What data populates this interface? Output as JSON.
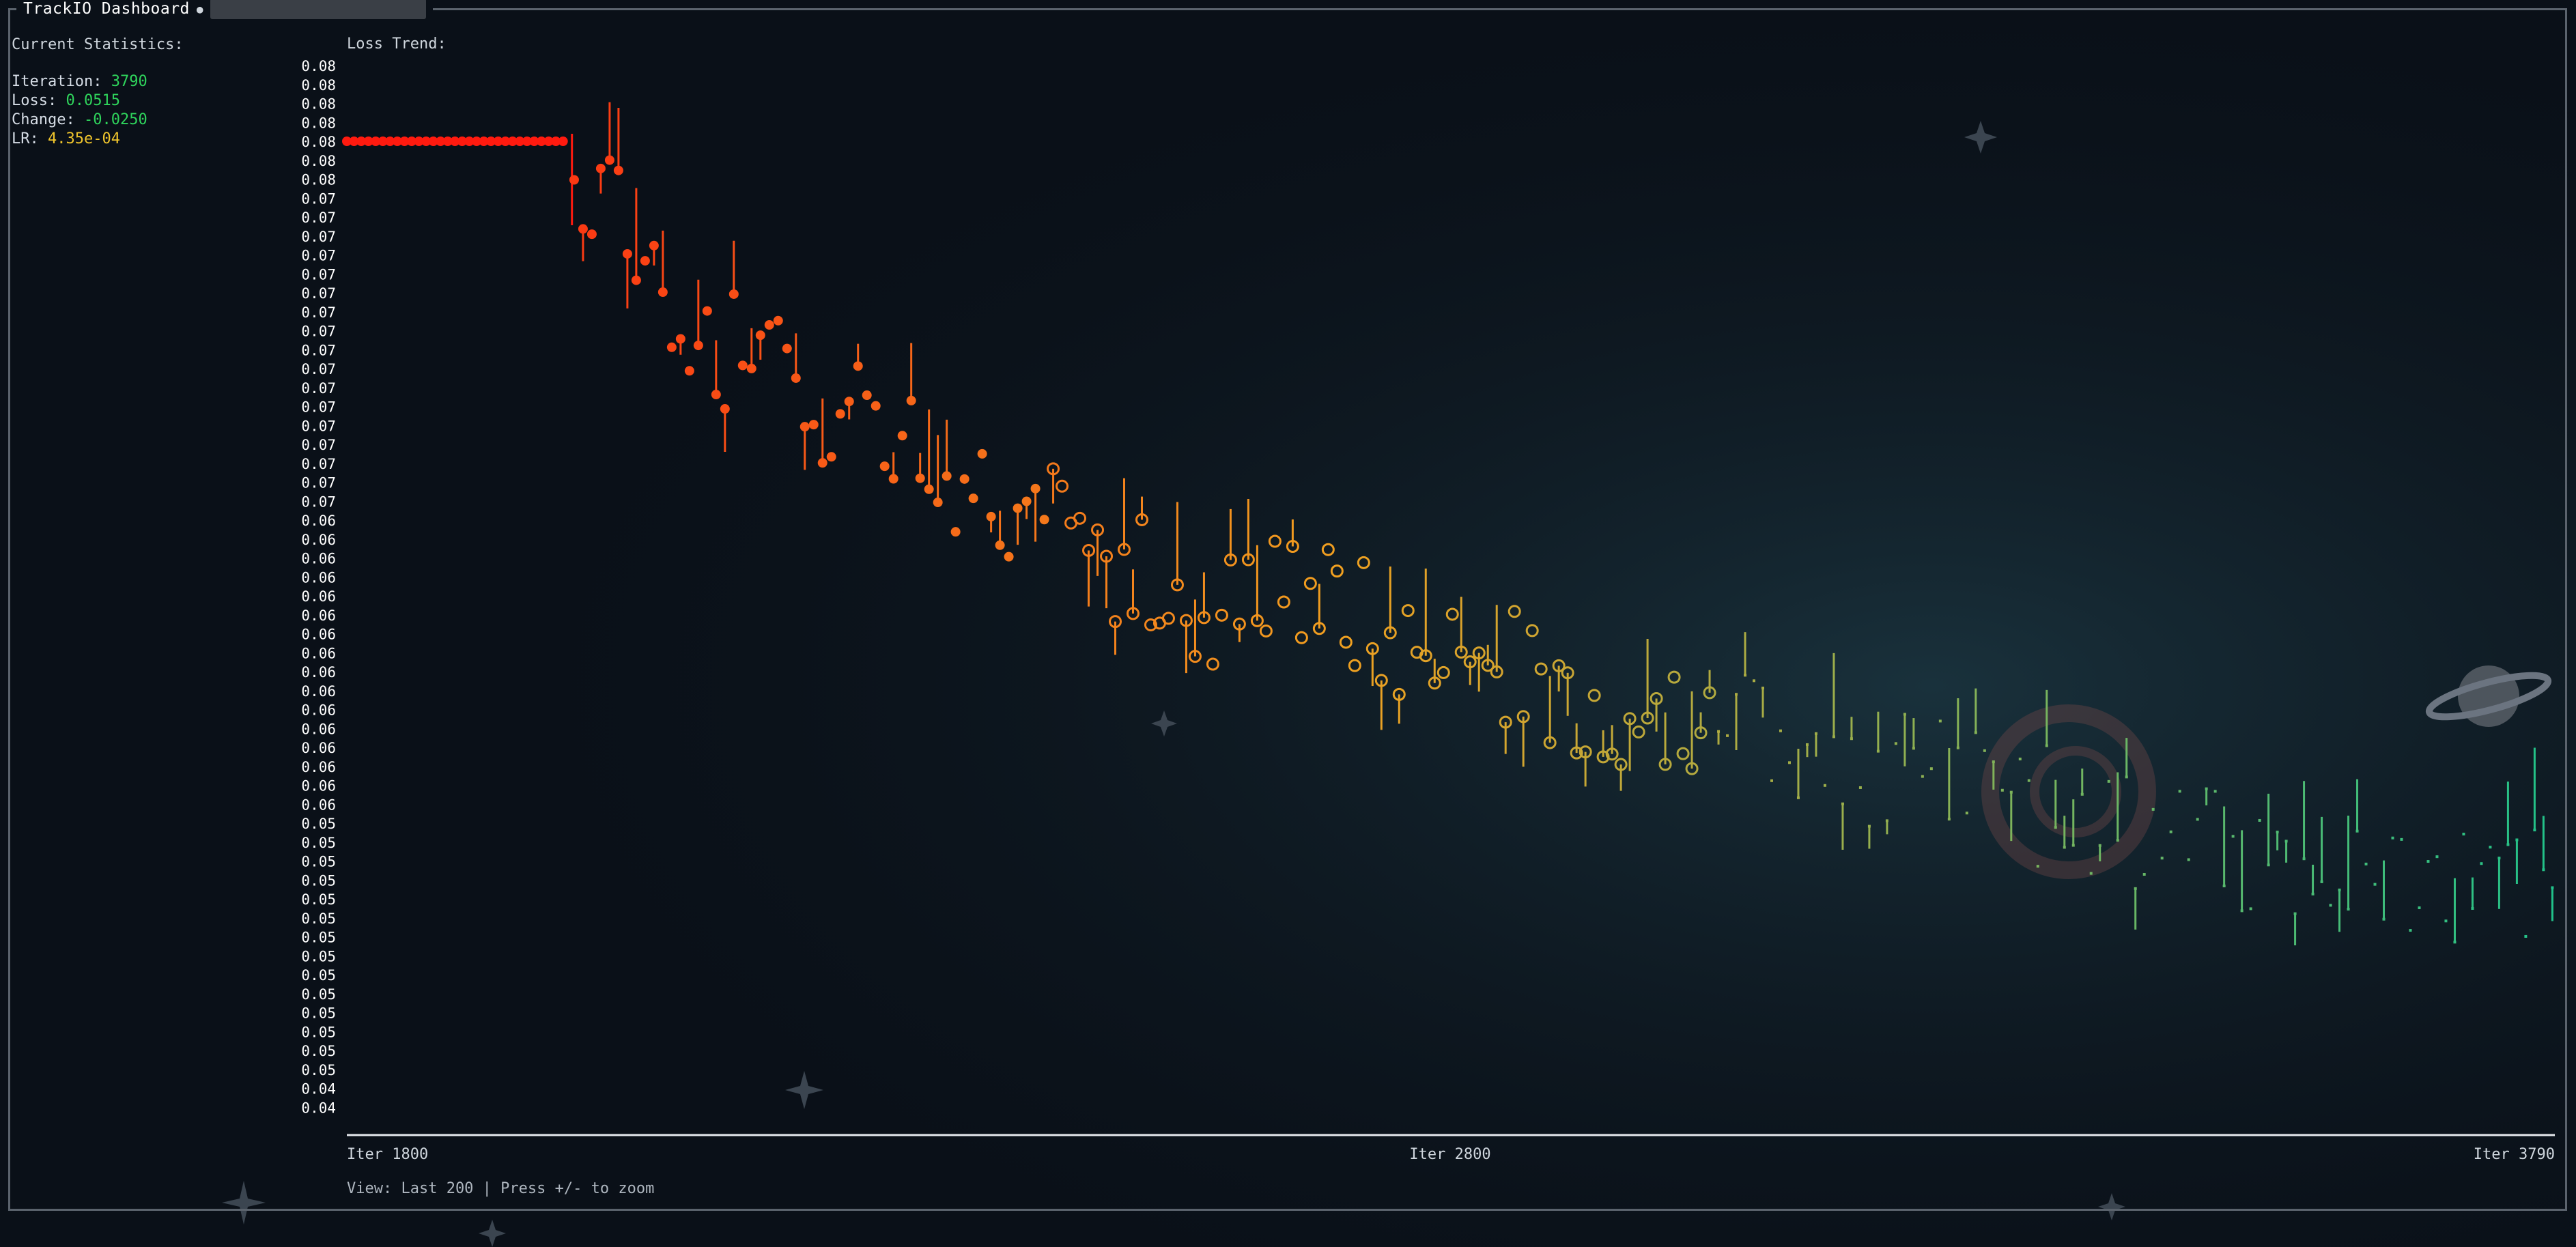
{
  "window": {
    "title": "TrackIO Dashboard"
  },
  "stats": {
    "heading": "Current Statistics:",
    "iteration_label": "Iteration:",
    "iteration": "3790",
    "loss_label": "Loss:",
    "loss": "0.0515",
    "change_label": "Change:",
    "change": "-0.0250",
    "lr_label": "LR:",
    "lr": "4.35e-04"
  },
  "trend_label": "Loss Trend:",
  "footer": "View: Last 200 | Press +/- to zoom",
  "colors": {
    "high": "#ff1a0f",
    "mid": "#f0a020",
    "low": "#21c28a",
    "stat_green": "#2fd55c",
    "stat_yellow": "#f0c52c"
  },
  "chart_data": {
    "type": "scatter",
    "title": "Loss Trend:",
    "x_tick_labels": [
      "Iter 1800",
      "Iter 2800",
      "Iter 3790"
    ],
    "xlim": [
      1800,
      3790
    ],
    "y_tick_labels": [
      "0.08",
      "0.08",
      "0.08",
      "0.08",
      "0.08",
      "0.08",
      "0.08",
      "0.07",
      "0.07",
      "0.07",
      "0.07",
      "0.07",
      "0.07",
      "0.07",
      "0.07",
      "0.07",
      "0.07",
      "0.07",
      "0.07",
      "0.07",
      "0.07",
      "0.07",
      "0.07",
      "0.07",
      "0.06",
      "0.06",
      "0.06",
      "0.06",
      "0.06",
      "0.06",
      "0.06",
      "0.06",
      "0.06",
      "0.06",
      "0.06",
      "0.06",
      "0.06",
      "0.06",
      "0.06",
      "0.06",
      "0.05",
      "0.05",
      "0.05",
      "0.05",
      "0.05",
      "0.05",
      "0.05",
      "0.05",
      "0.05",
      "0.05",
      "0.05",
      "0.05",
      "0.05",
      "0.05",
      "0.04",
      "0.04"
    ],
    "ylim": [
      0.0435,
      0.08
    ],
    "series": [
      {
        "x": [
          1800,
          2040,
          2070,
          2110,
          2150,
          2200,
          2250,
          2300,
          2350,
          2400,
          2450,
          2500,
          2550,
          2600,
          2650,
          2700,
          2750,
          2800,
          2850,
          2900,
          2950,
          3000,
          3050,
          3100,
          3150,
          3200,
          3250,
          3300,
          3350,
          3400,
          3450,
          3500,
          3550,
          3600,
          3650,
          3700,
          3750,
          3790
        ],
        "y": [
          0.0765,
          0.076,
          0.0735,
          0.0705,
          0.07,
          0.069,
          0.068,
          0.067,
          0.066,
          0.065,
          0.064,
          0.0625,
          0.0615,
          0.061,
          0.062,
          0.061,
          0.06,
          0.0595,
          0.059,
          0.0585,
          0.0575,
          0.0575,
          0.057,
          0.0565,
          0.056,
          0.0555,
          0.055,
          0.0545,
          0.054,
          0.0535,
          0.053,
          0.0525,
          0.0523,
          0.052,
          0.0518,
          0.0517,
          0.0516,
          0.0515
        ]
      }
    ]
  }
}
